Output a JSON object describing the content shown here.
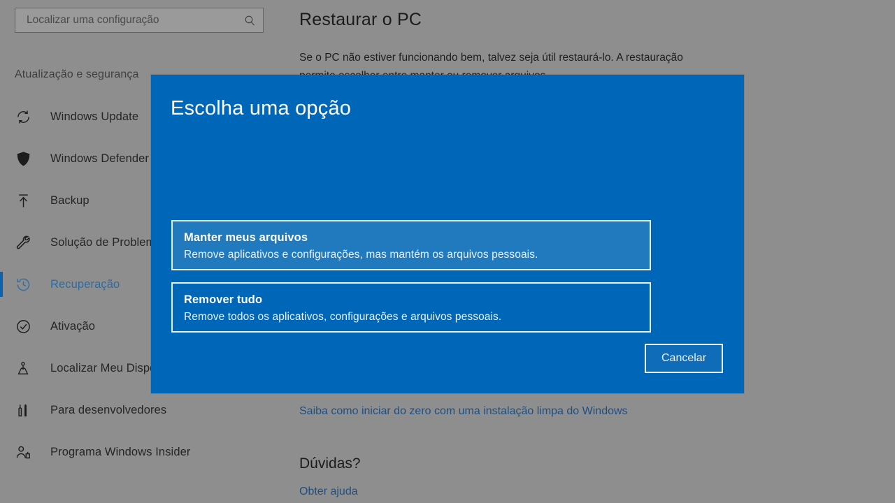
{
  "search": {
    "placeholder": "Localizar uma configuração",
    "value": "",
    "icon": "search-icon"
  },
  "sidebar": {
    "category": "Atualização e segurança",
    "items": [
      {
        "label": "Windows Update",
        "icon": "refresh-icon",
        "selected": false
      },
      {
        "label": "Windows Defender",
        "icon": "shield-icon",
        "selected": false
      },
      {
        "label": "Backup",
        "icon": "upload-arrow-icon",
        "selected": false
      },
      {
        "label": "Solução de Problemas",
        "icon": "wrench-icon",
        "selected": false
      },
      {
        "label": "Recuperação",
        "icon": "history-clock-icon",
        "selected": true
      },
      {
        "label": "Ativação",
        "icon": "check-circle-icon",
        "selected": false
      },
      {
        "label": "Localizar Meu Dispositivo",
        "icon": "find-device-icon",
        "selected": false
      },
      {
        "label": "Para desenvolvedores",
        "icon": "tools-icon",
        "selected": false
      },
      {
        "label": "Programa Windows Insider",
        "icon": "person-insider-icon",
        "selected": false
      }
    ]
  },
  "main": {
    "title": "Restaurar o PC",
    "description": "Se o PC não estiver funcionando bem, talvez seja útil restaurá-lo. A restauração permite escolher entre manter ou remover arquivos,",
    "clean_install_link": "Saiba como iniciar do zero com uma instalação limpa do Windows",
    "doubts_heading": "Dúvidas?",
    "help_link": "Obter ajuda"
  },
  "dialog": {
    "title": "Escolha uma opção",
    "options": [
      {
        "title": "Manter meus arquivos",
        "subtitle": "Remove aplicativos e configurações, mas mantém os arquivos pessoais.",
        "highlighted": true
      },
      {
        "title": "Remover tudo",
        "subtitle": "Remove todos os aplicativos, configurações e arquivos pessoais.",
        "highlighted": false
      }
    ],
    "cancel_label": "Cancelar"
  },
  "colors": {
    "dialog_blue": "#0066b8",
    "option_highlight_blue": "#2179be",
    "accent_selected": "#0b63b0",
    "link_blue": "#1f4f82",
    "app_background": "#8e8e8e"
  }
}
